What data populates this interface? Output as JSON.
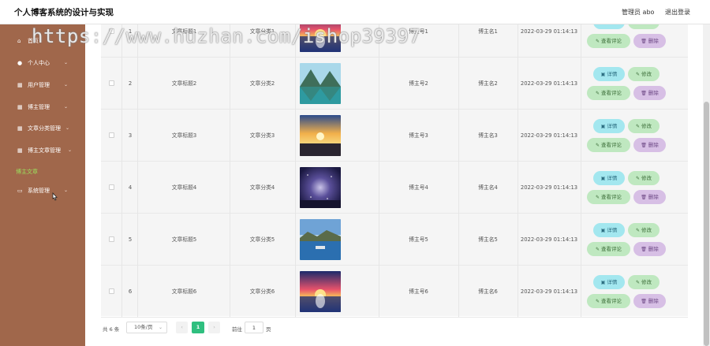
{
  "header": {
    "app_title": "个人博客系统的设计与实现",
    "admin_label": "管理员 abo",
    "logout_label": "退出登录"
  },
  "sidebar": {
    "items": [
      {
        "label": "首页",
        "icon": "home-icon",
        "chevron": false,
        "active": false
      },
      {
        "label": "个人中心",
        "icon": "user-icon",
        "chevron": true,
        "active": false
      },
      {
        "label": "用户管理",
        "icon": "grid-icon",
        "chevron": true,
        "active": false
      },
      {
        "label": "博主管理",
        "icon": "grid-icon",
        "chevron": true,
        "active": false
      },
      {
        "label": "文章分类管理",
        "icon": "grid-icon",
        "chevron": true,
        "active": false
      },
      {
        "label": "博主文章管理",
        "icon": "grid-icon",
        "chevron": true,
        "active": false
      },
      {
        "label": "博主文章",
        "icon": "",
        "chevron": false,
        "active": true
      },
      {
        "label": "系统管理",
        "icon": "monitor-icon",
        "chevron": true,
        "active": false
      }
    ]
  },
  "table": {
    "rows": [
      {
        "index": "1",
        "title": "文章标题1",
        "category": "文章分类1",
        "account": "博主号1",
        "name": "博主名1",
        "time": "2022-03-29 01:14:13",
        "image": "sunset-lake"
      },
      {
        "index": "2",
        "title": "文章标题2",
        "category": "文章分类2",
        "account": "博主号2",
        "name": "博主名2",
        "time": "2022-03-29 01:14:13",
        "image": "mountain-lake"
      },
      {
        "index": "3",
        "title": "文章标题3",
        "category": "文章分类3",
        "account": "博主号3",
        "name": "博主名3",
        "time": "2022-03-29 01:14:13",
        "image": "sunset-sky"
      },
      {
        "index": "4",
        "title": "文章标题4",
        "category": "文章分类4",
        "account": "博主号4",
        "name": "博主名4",
        "time": "2022-03-29 01:14:13",
        "image": "starry-night"
      },
      {
        "index": "5",
        "title": "文章标题5",
        "category": "文章分类5",
        "account": "博主号5",
        "name": "博主名5",
        "time": "2022-03-29 01:14:13",
        "image": "blue-lake"
      },
      {
        "index": "6",
        "title": "文章标题6",
        "category": "文章分类6",
        "account": "博主号6",
        "name": "博主名6",
        "time": "2022-03-29 01:14:13",
        "image": "sunset-lake"
      }
    ],
    "actions": {
      "detail": "详情",
      "edit": "修改",
      "comments": "查看评论",
      "delete": "删除"
    }
  },
  "pagination": {
    "total": "共 6 条",
    "page_size": "10条/页",
    "current_page": "1",
    "goto_label": "前往",
    "goto_value": "1",
    "page_unit": "页"
  },
  "watermark": "https://www.huzhan.com/ishop39397",
  "colors": {
    "sidebar": "#a0674b",
    "active_nav": "#9be15d",
    "detail_button": "#a3e7ef",
    "edit_button": "#bfe8c0",
    "delete_button": "#d7bfe5",
    "current_page": "#2fbf7f"
  }
}
